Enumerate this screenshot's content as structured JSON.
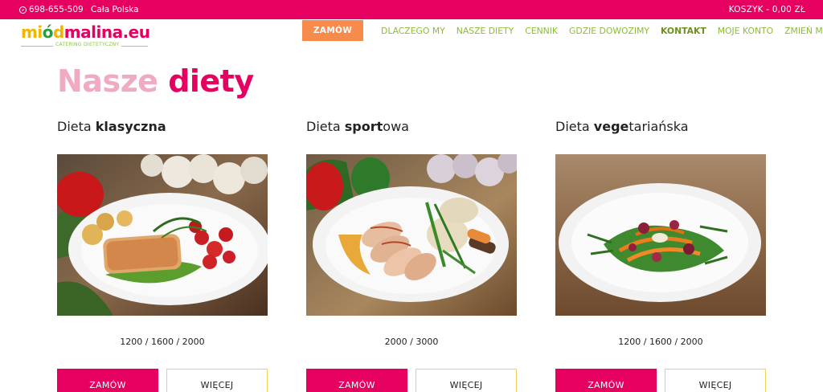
{
  "topbar": {
    "phone": "698-655-509",
    "region": "Cała Polska",
    "cart": "KOSZYK - 0,00 ZŁ"
  },
  "logo": {
    "part1": "mi",
    "part_o": "ó",
    "part2": "d",
    "part3": "malina.eu",
    "tagline": "CATERING DIETETYCZNY"
  },
  "header": {
    "order_button": "ZAMÓW",
    "nav": [
      {
        "label": "DLACZEGO MY"
      },
      {
        "label": "NASZE DIETY"
      },
      {
        "label": "CENNIK"
      },
      {
        "label": "GDZIE DOWOZIMY"
      },
      {
        "label": "KONTAKT",
        "active": true
      },
      {
        "label": "MOJE KONTO"
      },
      {
        "label": "ZMIEŃ MIASTO"
      }
    ]
  },
  "heading": {
    "light": "Nasze",
    "dark": "diety"
  },
  "diets": [
    {
      "prefix": "Dieta ",
      "bold": "klasyczna",
      "suffix": "",
      "kcal": "1200 / 1600 / 2000",
      "order": "ZAMÓW",
      "more": "WIĘCEJ"
    },
    {
      "prefix": "Dieta ",
      "bold": "sport",
      "suffix": "owa",
      "kcal": "2000 / 3000",
      "order": "ZAMÓW",
      "more": "WIĘCEJ"
    },
    {
      "prefix": "Dieta ",
      "bold": "vege",
      "suffix": "tariańska",
      "kcal": "1200 / 1600 / 2000",
      "order": "ZAMÓW",
      "more": "WIĘCEJ"
    }
  ],
  "colors": {
    "brand_pink": "#e6005f",
    "accent_orange": "#f78b4b",
    "nav_green": "#8dbb35"
  }
}
